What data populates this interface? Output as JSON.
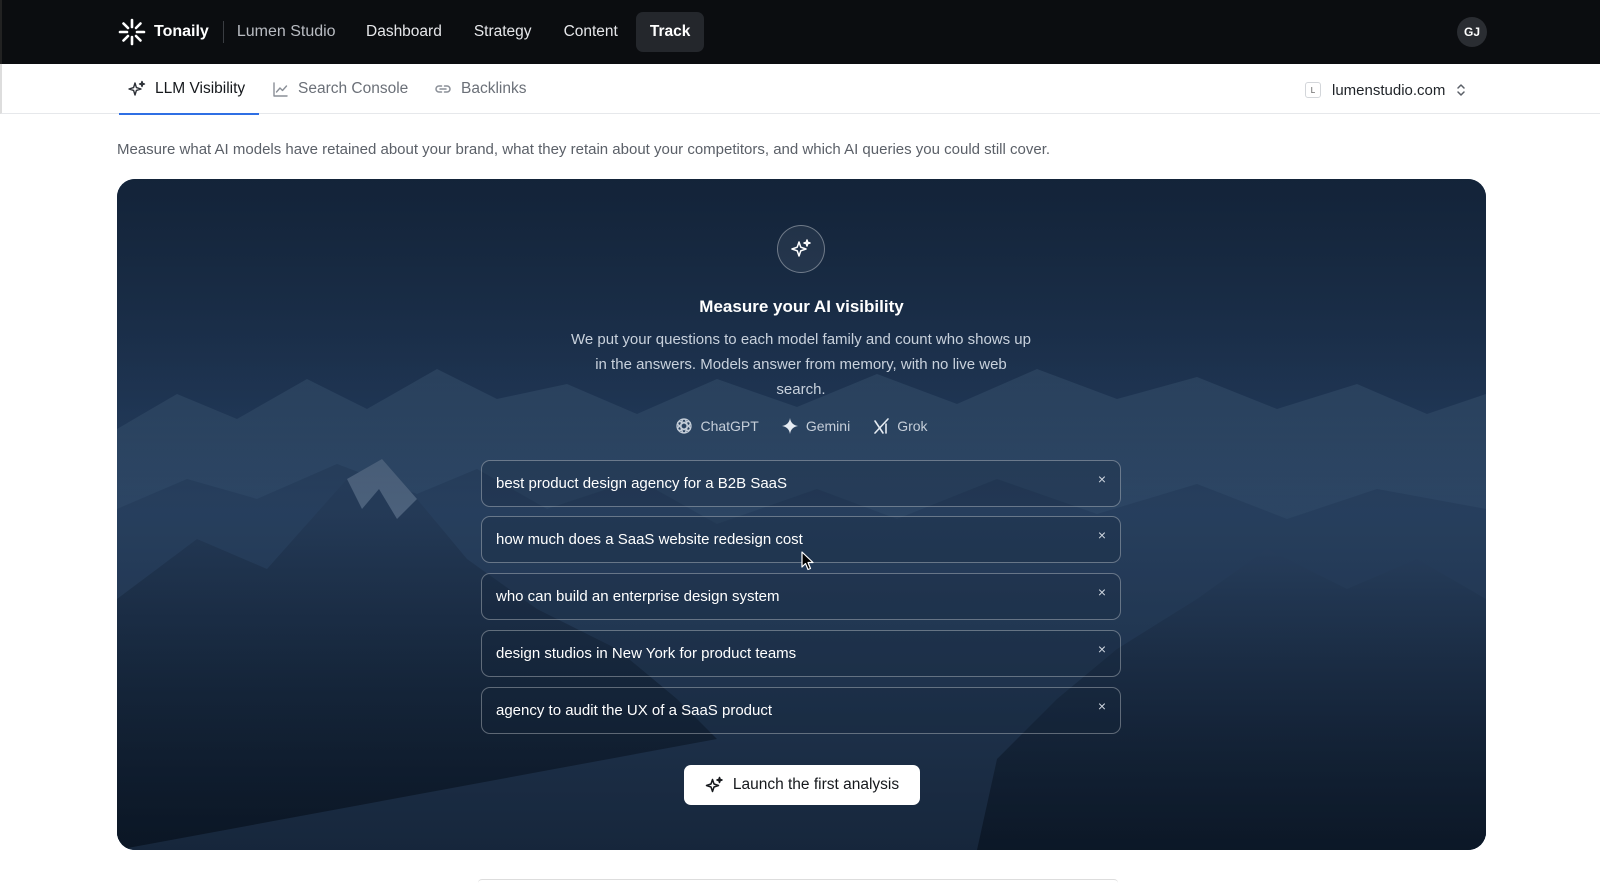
{
  "topbar": {
    "brand": "Tonaily",
    "workspace": "Lumen Studio",
    "nav": [
      {
        "label": "Dashboard",
        "active": false
      },
      {
        "label": "Strategy",
        "active": false
      },
      {
        "label": "Content",
        "active": false
      },
      {
        "label": "Track",
        "active": true
      }
    ],
    "avatar_initials": "GJ"
  },
  "subnav": {
    "tabs": [
      {
        "label": "LLM Visibility",
        "icon": "sparkle-icon",
        "active": true
      },
      {
        "label": "Search Console",
        "icon": "line-chart-icon",
        "active": false
      },
      {
        "label": "Backlinks",
        "icon": "link-icon",
        "active": false
      }
    ],
    "domain": {
      "favicon_letter": "L",
      "value": "lumenstudio.com"
    }
  },
  "intro_text": "Measure what AI models have retained about your brand, what they retain about your competitors, and which AI queries you could still cover.",
  "hero": {
    "title": "Measure your AI visibility",
    "description": "We put your questions to each model family and count who shows up in the answers. Models answer from memory, with no live web search.",
    "models": [
      {
        "name": "ChatGPT",
        "icon": "openai-icon"
      },
      {
        "name": "Gemini",
        "icon": "gemini-icon"
      },
      {
        "name": "Grok",
        "icon": "grok-icon"
      }
    ],
    "queries": [
      "best product design agency for a B2B SaaS",
      "how much does a SaaS website redesign cost",
      "who can build an enterprise design system",
      "design studios in New York for product teams",
      "agency to audit the UX of a SaaS product"
    ],
    "remove_glyph": "×",
    "launch_label": "Launch the first analysis"
  },
  "colors": {
    "topbar_bg": "#0b0d10",
    "accent": "#2f6fe4",
    "hero_bg": "#1d3350"
  }
}
